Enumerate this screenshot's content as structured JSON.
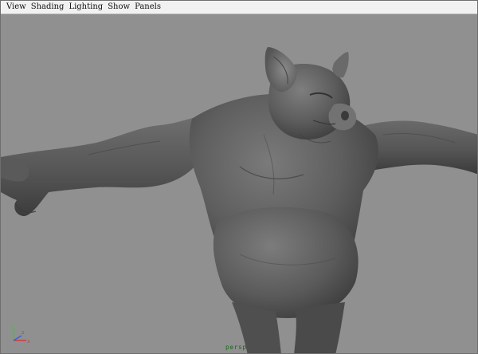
{
  "menubar": {
    "items": [
      {
        "label": "View"
      },
      {
        "label": "Shading"
      },
      {
        "label": "Lighting"
      },
      {
        "label": "Show"
      },
      {
        "label": "Panels"
      }
    ]
  },
  "viewport": {
    "camera_label": "persp",
    "model": "pig-character-sculpt",
    "axes": {
      "x": "x",
      "y": "y",
      "z": "z"
    },
    "colors": {
      "background": "#909090",
      "model_base": "#5a5a5a",
      "axis_x": "#d23a3a",
      "axis_y": "#3ec43e",
      "axis_z": "#3b5fd8"
    }
  }
}
